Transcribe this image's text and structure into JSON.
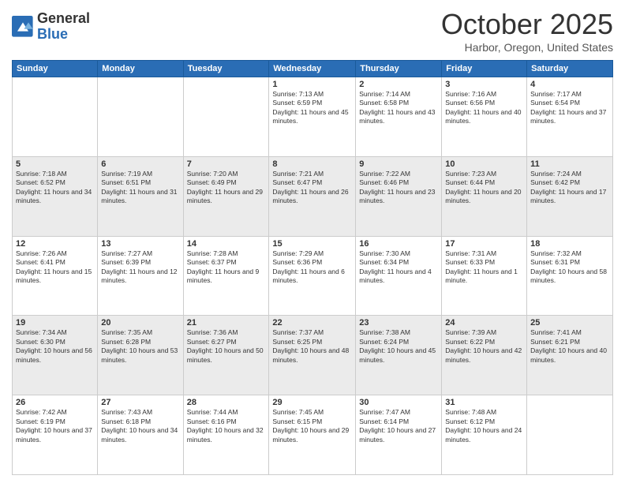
{
  "header": {
    "logo_general": "General",
    "logo_blue": "Blue",
    "title": "October 2025",
    "location": "Harbor, Oregon, United States"
  },
  "days_of_week": [
    "Sunday",
    "Monday",
    "Tuesday",
    "Wednesday",
    "Thursday",
    "Friday",
    "Saturday"
  ],
  "weeks": [
    [
      {
        "day": "",
        "info": ""
      },
      {
        "day": "",
        "info": ""
      },
      {
        "day": "",
        "info": ""
      },
      {
        "day": "1",
        "info": "Sunrise: 7:13 AM\nSunset: 6:59 PM\nDaylight: 11 hours and 45 minutes."
      },
      {
        "day": "2",
        "info": "Sunrise: 7:14 AM\nSunset: 6:58 PM\nDaylight: 11 hours and 43 minutes."
      },
      {
        "day": "3",
        "info": "Sunrise: 7:16 AM\nSunset: 6:56 PM\nDaylight: 11 hours and 40 minutes."
      },
      {
        "day": "4",
        "info": "Sunrise: 7:17 AM\nSunset: 6:54 PM\nDaylight: 11 hours and 37 minutes."
      }
    ],
    [
      {
        "day": "5",
        "info": "Sunrise: 7:18 AM\nSunset: 6:52 PM\nDaylight: 11 hours and 34 minutes."
      },
      {
        "day": "6",
        "info": "Sunrise: 7:19 AM\nSunset: 6:51 PM\nDaylight: 11 hours and 31 minutes."
      },
      {
        "day": "7",
        "info": "Sunrise: 7:20 AM\nSunset: 6:49 PM\nDaylight: 11 hours and 29 minutes."
      },
      {
        "day": "8",
        "info": "Sunrise: 7:21 AM\nSunset: 6:47 PM\nDaylight: 11 hours and 26 minutes."
      },
      {
        "day": "9",
        "info": "Sunrise: 7:22 AM\nSunset: 6:46 PM\nDaylight: 11 hours and 23 minutes."
      },
      {
        "day": "10",
        "info": "Sunrise: 7:23 AM\nSunset: 6:44 PM\nDaylight: 11 hours and 20 minutes."
      },
      {
        "day": "11",
        "info": "Sunrise: 7:24 AM\nSunset: 6:42 PM\nDaylight: 11 hours and 17 minutes."
      }
    ],
    [
      {
        "day": "12",
        "info": "Sunrise: 7:26 AM\nSunset: 6:41 PM\nDaylight: 11 hours and 15 minutes."
      },
      {
        "day": "13",
        "info": "Sunrise: 7:27 AM\nSunset: 6:39 PM\nDaylight: 11 hours and 12 minutes."
      },
      {
        "day": "14",
        "info": "Sunrise: 7:28 AM\nSunset: 6:37 PM\nDaylight: 11 hours and 9 minutes."
      },
      {
        "day": "15",
        "info": "Sunrise: 7:29 AM\nSunset: 6:36 PM\nDaylight: 11 hours and 6 minutes."
      },
      {
        "day": "16",
        "info": "Sunrise: 7:30 AM\nSunset: 6:34 PM\nDaylight: 11 hours and 4 minutes."
      },
      {
        "day": "17",
        "info": "Sunrise: 7:31 AM\nSunset: 6:33 PM\nDaylight: 11 hours and 1 minute."
      },
      {
        "day": "18",
        "info": "Sunrise: 7:32 AM\nSunset: 6:31 PM\nDaylight: 10 hours and 58 minutes."
      }
    ],
    [
      {
        "day": "19",
        "info": "Sunrise: 7:34 AM\nSunset: 6:30 PM\nDaylight: 10 hours and 56 minutes."
      },
      {
        "day": "20",
        "info": "Sunrise: 7:35 AM\nSunset: 6:28 PM\nDaylight: 10 hours and 53 minutes."
      },
      {
        "day": "21",
        "info": "Sunrise: 7:36 AM\nSunset: 6:27 PM\nDaylight: 10 hours and 50 minutes."
      },
      {
        "day": "22",
        "info": "Sunrise: 7:37 AM\nSunset: 6:25 PM\nDaylight: 10 hours and 48 minutes."
      },
      {
        "day": "23",
        "info": "Sunrise: 7:38 AM\nSunset: 6:24 PM\nDaylight: 10 hours and 45 minutes."
      },
      {
        "day": "24",
        "info": "Sunrise: 7:39 AM\nSunset: 6:22 PM\nDaylight: 10 hours and 42 minutes."
      },
      {
        "day": "25",
        "info": "Sunrise: 7:41 AM\nSunset: 6:21 PM\nDaylight: 10 hours and 40 minutes."
      }
    ],
    [
      {
        "day": "26",
        "info": "Sunrise: 7:42 AM\nSunset: 6:19 PM\nDaylight: 10 hours and 37 minutes."
      },
      {
        "day": "27",
        "info": "Sunrise: 7:43 AM\nSunset: 6:18 PM\nDaylight: 10 hours and 34 minutes."
      },
      {
        "day": "28",
        "info": "Sunrise: 7:44 AM\nSunset: 6:16 PM\nDaylight: 10 hours and 32 minutes."
      },
      {
        "day": "29",
        "info": "Sunrise: 7:45 AM\nSunset: 6:15 PM\nDaylight: 10 hours and 29 minutes."
      },
      {
        "day": "30",
        "info": "Sunrise: 7:47 AM\nSunset: 6:14 PM\nDaylight: 10 hours and 27 minutes."
      },
      {
        "day": "31",
        "info": "Sunrise: 7:48 AM\nSunset: 6:12 PM\nDaylight: 10 hours and 24 minutes."
      },
      {
        "day": "",
        "info": ""
      }
    ]
  ]
}
